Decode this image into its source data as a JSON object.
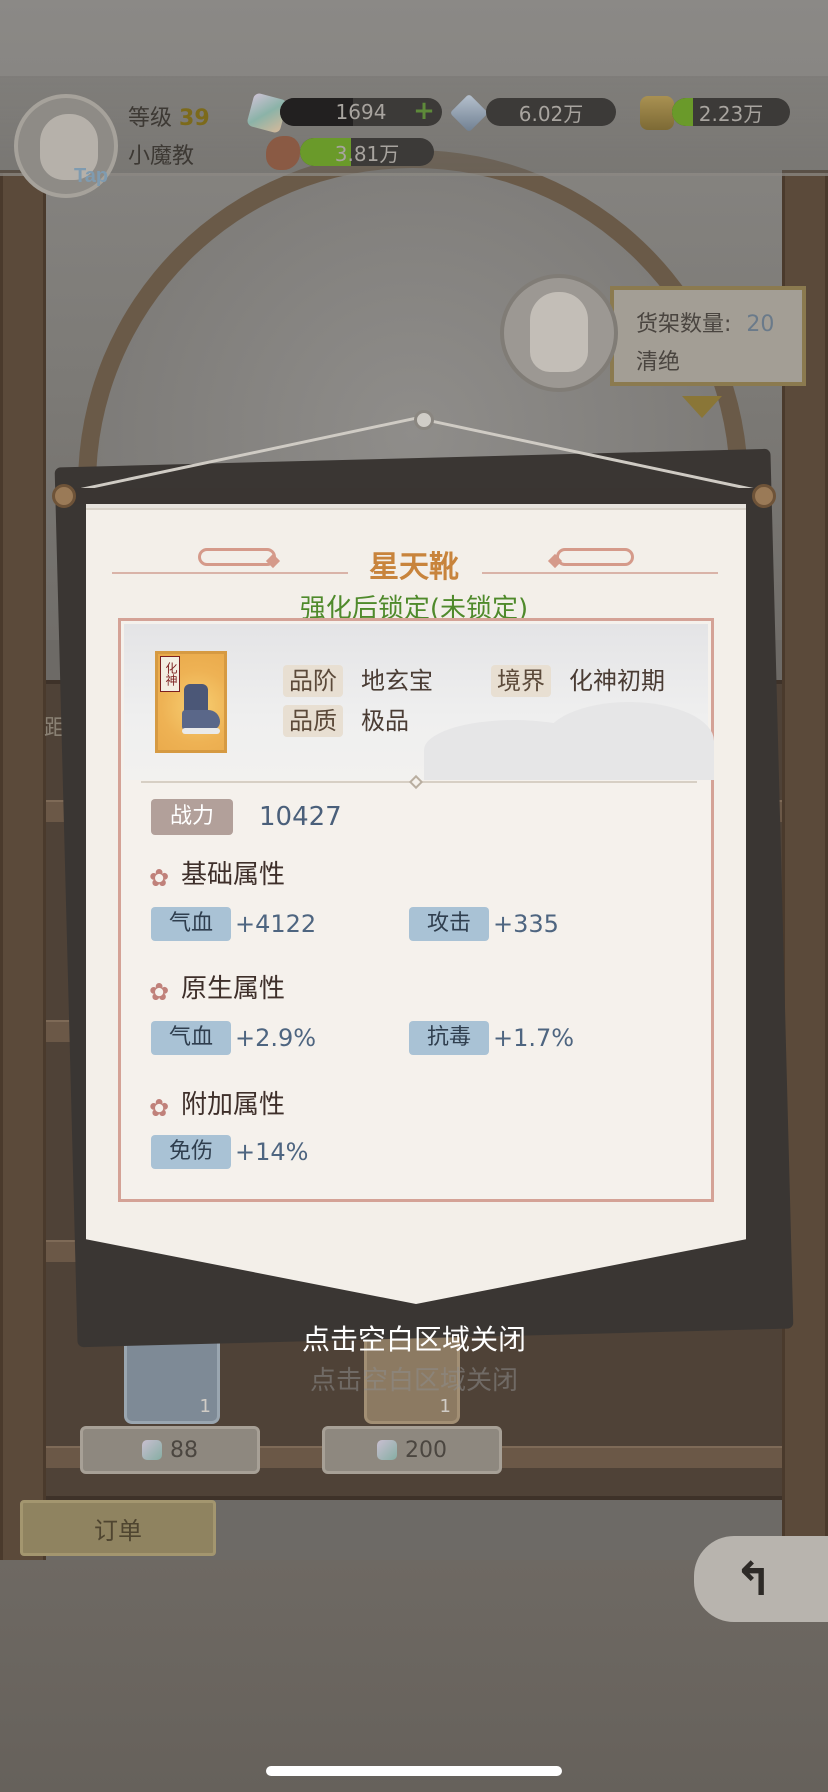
{
  "hud": {
    "level_label": "等级",
    "level_value": "39",
    "player_name": "小魔教",
    "tap_label": "Tap",
    "resources": [
      {
        "icon": "gem-icon",
        "value": "1694",
        "fill": 0.45,
        "fill_color": "#222020"
      },
      {
        "icon": "crystal-icon",
        "value": "6.02万",
        "fill": 0.0,
        "fill_color": "#222020"
      },
      {
        "icon": "gold-icon",
        "value": "2.23万",
        "fill": 0.18,
        "fill_color": "#6a9a2a"
      },
      {
        "icon": "meat-icon",
        "value": "3.81万",
        "fill": 0.38,
        "fill_color": "#6a9a2a"
      }
    ]
  },
  "shelf": {
    "count_label": "货架数量:",
    "count_value": "20",
    "clerk_name": "清绝"
  },
  "background": {
    "side_label": "距",
    "ghost_hint": "点击空白区域关闭",
    "items": [
      {
        "count": "1",
        "price": "88"
      },
      {
        "count": "1",
        "price": "200"
      }
    ],
    "order_label": "订单",
    "back_label": "↰"
  },
  "modal": {
    "title": "星天靴",
    "lock_status": "强化后锁定(未锁定)",
    "icon_tag": "化神",
    "grade_label": "品阶",
    "grade_value": "地玄宝",
    "realm_label": "境界",
    "realm_value": "化神初期",
    "quality_label": "品质",
    "quality_value": "极品",
    "power_label": "战力",
    "power_value": "10427",
    "sections": [
      {
        "title": "基础属性",
        "attrs": [
          {
            "label": "气血",
            "value": "+4122"
          },
          {
            "label": "攻击",
            "value": "+335"
          }
        ]
      },
      {
        "title": "原生属性",
        "attrs": [
          {
            "label": "气血",
            "value": "+2.9%"
          },
          {
            "label": "抗毒",
            "value": "+1.7%"
          }
        ]
      },
      {
        "title": "附加属性",
        "attrs": [
          {
            "label": "免伤",
            "value": "+14%"
          }
        ]
      }
    ],
    "close_hint": "点击空白区域关闭"
  },
  "colors": {
    "title": "#c8843c",
    "lock_status": "#4f8a2b",
    "attr_chip": "#a9c2d5",
    "attr_value": "#4e6580"
  }
}
